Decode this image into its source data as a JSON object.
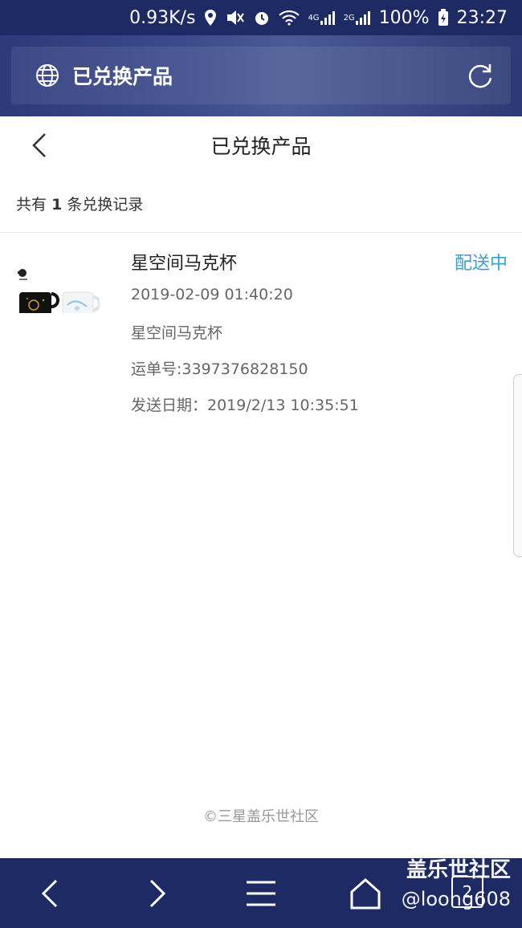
{
  "status_bar": {
    "speed": "0.93K/s",
    "net1": "4G",
    "net2": "2G",
    "battery": "100%",
    "time": "23:27"
  },
  "browser": {
    "title": "已兑换产品"
  },
  "page": {
    "title": "已兑换产品",
    "count_prefix": "共有",
    "count_value": "1",
    "count_suffix": "条兑换记录"
  },
  "items": [
    {
      "name": "星空间马克杯",
      "status": "配送中",
      "datetime": "2019-02-09 01:40:20",
      "desc": "星空间马克杯",
      "tracking": "运单号:3397376828150",
      "ship_date": "发送日期：2019/2/13 10:35:51"
    }
  ],
  "footer": {
    "copyright": "©三星盖乐世社区"
  },
  "watermark": {
    "line1": "盖乐世社区",
    "line2": "@loong608"
  },
  "nav": {
    "tab_count": "2"
  },
  "colors": {
    "status_accent": "#3aa0c8",
    "bar_bg": "#1e2a63"
  }
}
